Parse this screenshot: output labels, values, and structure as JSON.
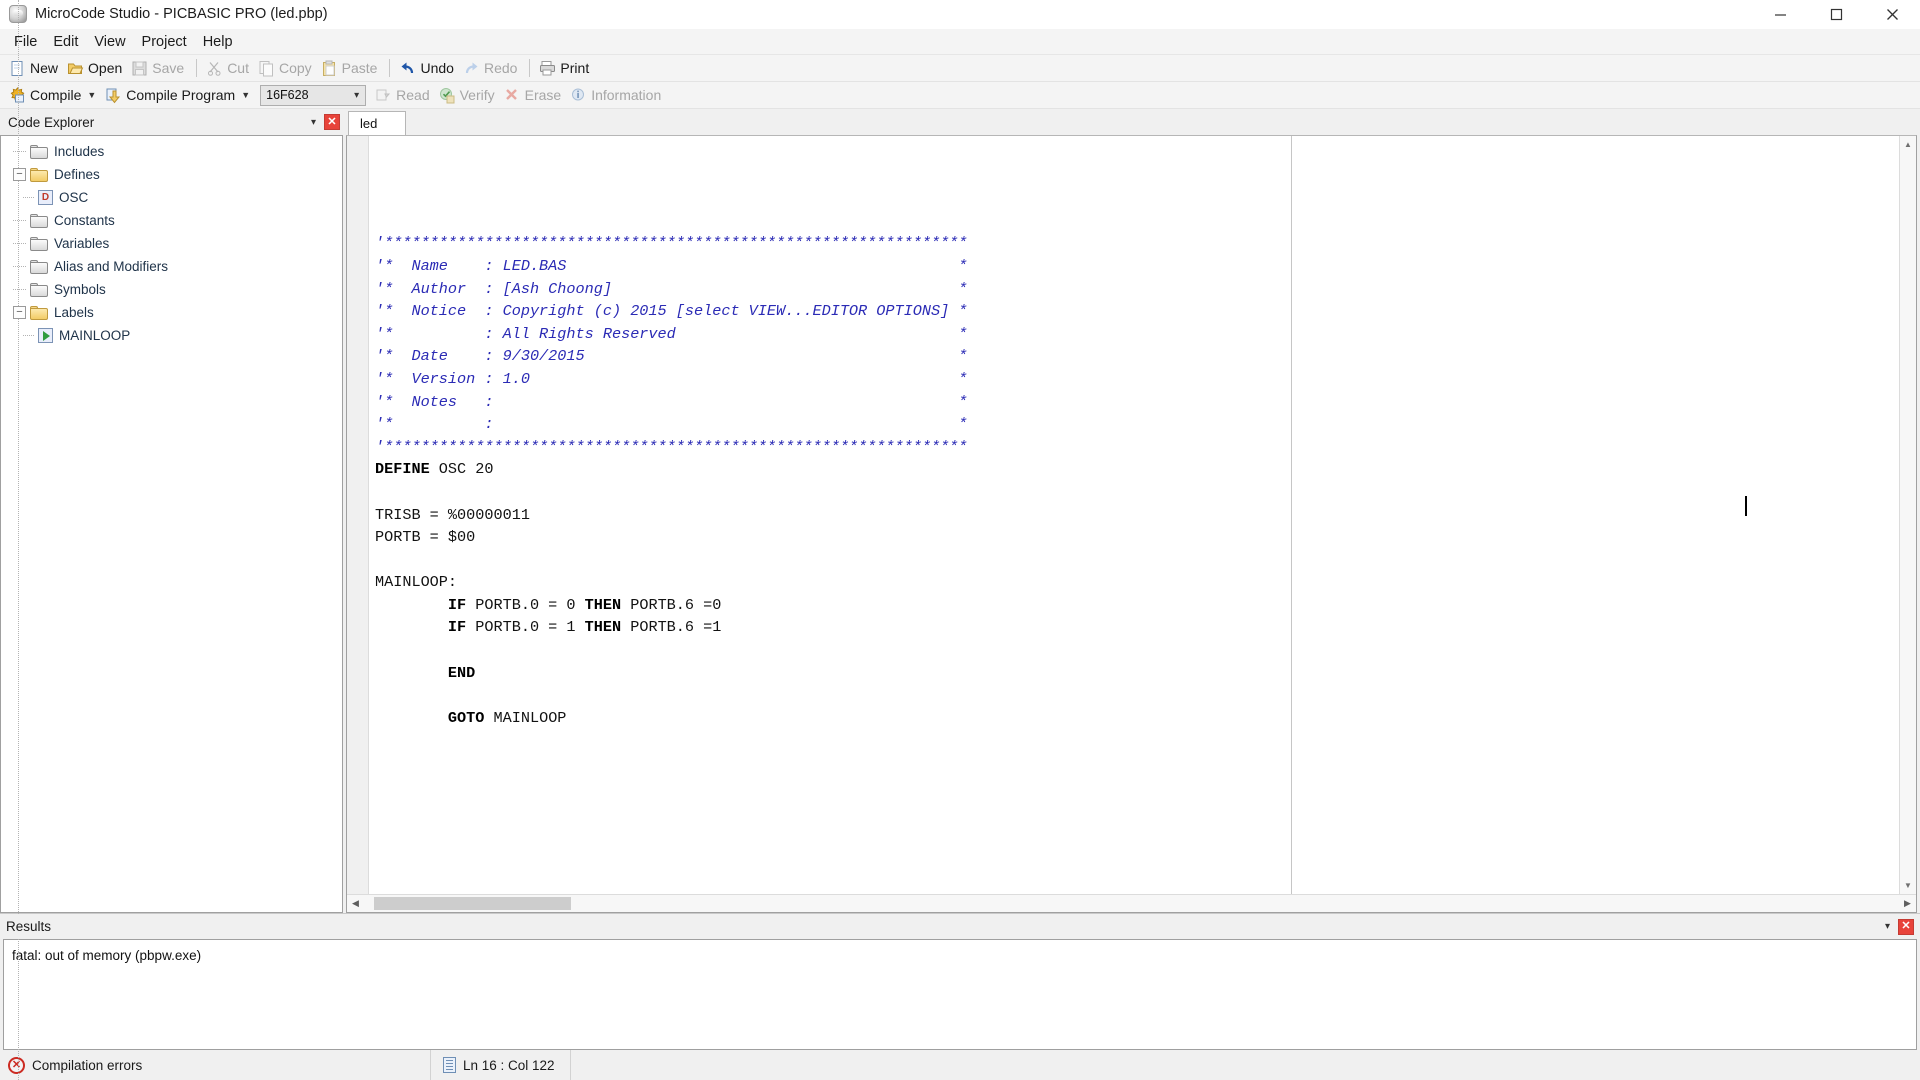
{
  "window": {
    "title": "MicroCode Studio - PICBASIC PRO (led.pbp)",
    "minimize_label": "–",
    "maximize_label": "☐",
    "close_label": "✕"
  },
  "menu": {
    "items": [
      {
        "label": "File"
      },
      {
        "label": "Edit"
      },
      {
        "label": "View"
      },
      {
        "label": "Project"
      },
      {
        "label": "Help"
      }
    ]
  },
  "toolbar_main": {
    "buttons": [
      {
        "label": "New",
        "icon": "new-document-icon",
        "enabled": true
      },
      {
        "label": "Open",
        "icon": "open-folder-icon",
        "enabled": true
      },
      {
        "label": "Save",
        "icon": "floppy-disk-icon",
        "enabled": false
      },
      {
        "label": "Cut",
        "icon": "scissors-icon",
        "enabled": false
      },
      {
        "label": "Copy",
        "icon": "copy-pages-icon",
        "enabled": false
      },
      {
        "label": "Paste",
        "icon": "clipboard-icon",
        "enabled": false
      },
      {
        "label": "Undo",
        "icon": "undo-arrow-icon",
        "enabled": true
      },
      {
        "label": "Redo",
        "icon": "redo-arrow-icon",
        "enabled": false
      },
      {
        "label": "Print",
        "icon": "printer-icon",
        "enabled": true
      }
    ]
  },
  "toolbar_compile": {
    "compile_label": "Compile",
    "compile_program_label": "Compile Program",
    "device_combo": {
      "value": "16F628",
      "arrow": "∨"
    },
    "buttons": [
      {
        "label": "Read",
        "icon": "read-chip-icon",
        "enabled": false
      },
      {
        "label": "Verify",
        "icon": "verify-check-icon",
        "enabled": false
      },
      {
        "label": "Erase",
        "icon": "erase-x-icon",
        "enabled": false
      },
      {
        "label": "Information",
        "icon": "info-circle-icon",
        "enabled": false
      }
    ]
  },
  "code_explorer": {
    "title": "Code Explorer",
    "collapse_caret": "▾",
    "close_label": "✕",
    "nodes": [
      {
        "label": "Includes",
        "icon": "folder-icon",
        "expander": "",
        "depth": 0
      },
      {
        "label": "Defines",
        "icon": "folder-open-icon",
        "expander": "−",
        "depth": 0
      },
      {
        "label": "OSC",
        "icon": "define-icon",
        "expander": "",
        "depth": 1,
        "glyph": "D"
      },
      {
        "label": "Constants",
        "icon": "folder-icon",
        "expander": "",
        "depth": 0
      },
      {
        "label": "Variables",
        "icon": "folder-icon",
        "expander": "",
        "depth": 0
      },
      {
        "label": "Alias and Modifiers",
        "icon": "folder-icon",
        "expander": "",
        "depth": 0
      },
      {
        "label": "Symbols",
        "icon": "folder-icon",
        "expander": "",
        "depth": 0
      },
      {
        "label": "Labels",
        "icon": "folder-open-icon",
        "expander": "−",
        "depth": 0
      },
      {
        "label": "MAINLOOP",
        "icon": "label-play-icon",
        "expander": "",
        "depth": 1
      }
    ]
  },
  "editor": {
    "tabs": [
      {
        "label": "led",
        "active": true
      }
    ],
    "lines": [
      {
        "segments": [
          {
            "text": "'****************************************************************",
            "style": "cmt"
          }
        ]
      },
      {
        "segments": [
          {
            "text": "'*  Name    : LED.BAS                                           *",
            "style": "cmt"
          }
        ]
      },
      {
        "segments": [
          {
            "text": "'*  Author  : [Ash Choong]                                      *",
            "style": "cmt"
          }
        ]
      },
      {
        "segments": [
          {
            "text": "'*  Notice  : Copyright (c) 2015 [select VIEW...EDITOR OPTIONS] *",
            "style": "cmt"
          }
        ]
      },
      {
        "segments": [
          {
            "text": "'*          : All Rights Reserved                               *",
            "style": "cmt"
          }
        ]
      },
      {
        "segments": [
          {
            "text": "'*  Date    : 9/30/2015                                         *",
            "style": "cmt"
          }
        ]
      },
      {
        "segments": [
          {
            "text": "'*  Version : 1.0                                               *",
            "style": "cmt"
          }
        ]
      },
      {
        "segments": [
          {
            "text": "'*  Notes   :                                                   *",
            "style": "cmt"
          }
        ]
      },
      {
        "segments": [
          {
            "text": "'*          :                                                   *",
            "style": "cmt"
          }
        ]
      },
      {
        "segments": [
          {
            "text": "'****************************************************************",
            "style": "cmt"
          }
        ]
      },
      {
        "segments": [
          {
            "text": "DEFINE",
            "style": "kw"
          },
          {
            "text": " OSC 20",
            "style": "plain"
          }
        ]
      },
      {
        "segments": [
          {
            "text": "",
            "style": "plain"
          }
        ]
      },
      {
        "segments": [
          {
            "text": "TRISB = %00000011",
            "style": "plain"
          }
        ]
      },
      {
        "segments": [
          {
            "text": "PORTB = $00",
            "style": "plain"
          }
        ]
      },
      {
        "segments": [
          {
            "text": "",
            "style": "plain"
          }
        ]
      },
      {
        "segments": [
          {
            "text": "MAINLOOP:",
            "style": "plain"
          }
        ]
      },
      {
        "segments": [
          {
            "text": "        ",
            "style": "plain"
          },
          {
            "text": "IF",
            "style": "kw"
          },
          {
            "text": " PORTB.0 = 0 ",
            "style": "plain"
          },
          {
            "text": "THEN",
            "style": "kw"
          },
          {
            "text": " PORTB.6 =0",
            "style": "plain"
          }
        ]
      },
      {
        "segments": [
          {
            "text": "        ",
            "style": "plain"
          },
          {
            "text": "IF",
            "style": "kw"
          },
          {
            "text": " PORTB.0 = 1 ",
            "style": "plain"
          },
          {
            "text": "THEN",
            "style": "kw"
          },
          {
            "text": " PORTB.6 =1",
            "style": "plain"
          }
        ]
      },
      {
        "segments": [
          {
            "text": "",
            "style": "plain"
          }
        ]
      },
      {
        "segments": [
          {
            "text": "        ",
            "style": "plain"
          },
          {
            "text": "END",
            "style": "kw"
          }
        ]
      },
      {
        "segments": [
          {
            "text": "",
            "style": "plain"
          }
        ]
      },
      {
        "segments": [
          {
            "text": "        ",
            "style": "plain"
          },
          {
            "text": "GOTO",
            "style": "kw"
          },
          {
            "text": " MAINLOOP",
            "style": "plain"
          }
        ]
      }
    ],
    "hscroll_left_arrow": "◀",
    "hscroll_right_arrow": "▶",
    "vscroll_up_arrow": "▲",
    "vscroll_down_arrow": "▼"
  },
  "results": {
    "title": "Results",
    "collapse_caret": "▾",
    "close_label": "✕",
    "lines": [
      "fatal: out of memory (pbpw.exe)"
    ]
  },
  "status_bar": {
    "message": "Compilation errors",
    "message_icon": "error-circle-icon",
    "position": "Ln 16 : Col 122",
    "position_icon": "line-column-icon"
  },
  "colors": {
    "comment_blue": "#2b2bb5",
    "tree_text": "#20344a",
    "error_red": "#cc2b22",
    "close_red": "#e8433a",
    "chrome_gray": "#f0f0f0"
  }
}
